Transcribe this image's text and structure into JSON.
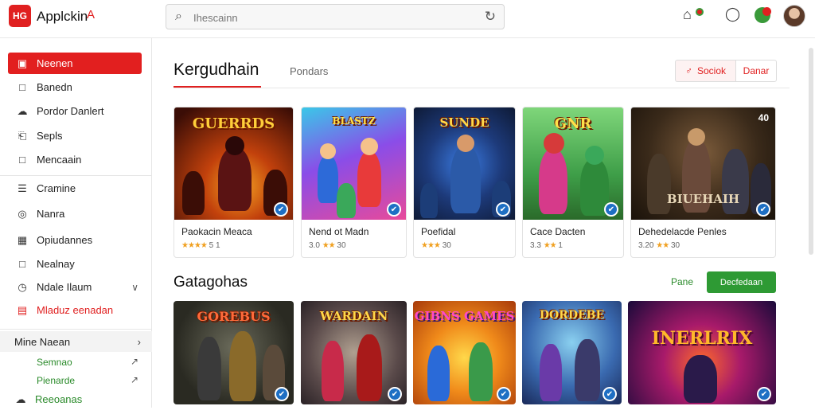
{
  "app": {
    "logo_text": "HG",
    "name": "Applckin",
    "name_mark": "A"
  },
  "search": {
    "placeholder": "Ihescainn"
  },
  "sidebar": {
    "items": [
      {
        "label": "Neenen",
        "icon": "home-icon"
      },
      {
        "label": "Banedn",
        "icon": "bookmark-icon"
      },
      {
        "label": "Pordor Danlert",
        "icon": "cloud-icon"
      },
      {
        "label": "Sepls",
        "icon": "document-icon"
      },
      {
        "label": "Mencaain",
        "icon": "square-icon"
      },
      {
        "label": "Cramine",
        "icon": "list-icon"
      },
      {
        "label": "Nanra",
        "icon": "pin-icon"
      },
      {
        "label": "Opiudannes",
        "icon": "grid-icon"
      },
      {
        "label": "Nealnay",
        "icon": "box-icon"
      },
      {
        "label": "Ndale Ilaum",
        "icon": "clock-icon"
      },
      {
        "label": "Mladuz eenadan",
        "icon": "calendar-icon"
      }
    ],
    "more": {
      "label": "Mine Naean",
      "links": [
        {
          "label": "Semnao"
        },
        {
          "label": "Pienarde"
        },
        {
          "label": "Reeoanas"
        }
      ]
    }
  },
  "main": {
    "title": "Kergudhain",
    "tab_label": "Pondars",
    "segment": {
      "left": "Sociok",
      "right": "Danar"
    }
  },
  "games": [
    {
      "art_title": "GUERRDS",
      "title": "Paokacin Meaca",
      "rating": "4.1",
      "stars": "★★★★",
      "meta": "5 1"
    },
    {
      "art_title": "BLASTZ",
      "title": "Nend ot Madn",
      "rating": "3.0",
      "stars": "★★",
      "meta": "30"
    },
    {
      "art_title": "SUNDE",
      "title": "Poefidal",
      "rating": "",
      "stars": "★★★",
      "meta": "30"
    },
    {
      "art_title": "GNR",
      "title": "Cace Dacten",
      "rating": "3.3",
      "stars": "★★",
      "meta": "1"
    },
    {
      "art_title": "BIUEHAIH",
      "title": "Dehedelacde Penles",
      "rating": "3.20",
      "stars": "★★",
      "meta": "30"
    }
  ],
  "game_badge": "40",
  "categories": {
    "title": "Gatagohas",
    "more_label": "Pane",
    "button_label": "Decfedaan",
    "items": [
      {
        "art_title": "GOREBUS"
      },
      {
        "art_title": "WARDAIN"
      },
      {
        "art_title": "GIBNS GAMES"
      },
      {
        "art_title": "DORDEBE"
      },
      {
        "art_title": "INERLRIX"
      }
    ]
  },
  "colors": {
    "accent": "#e21f1f",
    "green": "#2e9a34",
    "check": "#1e6fc4"
  }
}
